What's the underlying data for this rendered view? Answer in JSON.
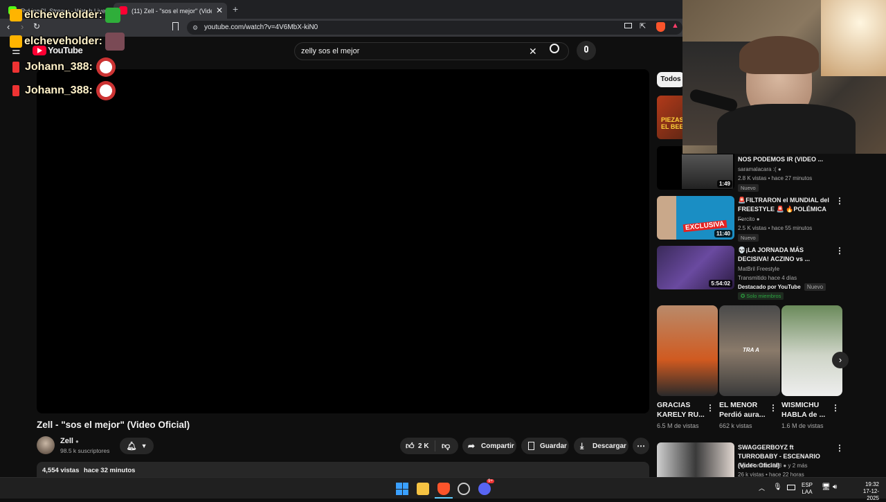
{
  "browser": {
    "tabs": [
      {
        "label": "RykingCL Stream - Watch Live on Kick",
        "active": false
      },
      {
        "label": "(11) Zell - \"sos el mejor\" (Video Oficial)",
        "active": true
      }
    ],
    "url": "youtube.com/watch?v=4V6MbX-kiN0"
  },
  "youtube": {
    "logo": "YouTube",
    "search_value": "zelly sos el mejor",
    "video": {
      "title": "Zell - \"sos el mejor\" (Video Oficial)",
      "channel": "Zell",
      "subscribers": "98.5 k suscriptores",
      "likes": "2 K",
      "share_label": "Compartir",
      "save_label": "Guardar",
      "download_label": "Descargar",
      "views": "4,554 vistas",
      "time": "hace 32 minutos"
    },
    "filter_chip": "Todos",
    "recommendations": [
      {
        "title": "NOS PODEMOS IR (VIDEO ...",
        "channel": "saramalacara :(",
        "meta": "2.8 K vistas • hace 27 minutos",
        "badge": "Nuevo",
        "duration": "1:49"
      },
      {
        "title": "🚨FILTRARON el MUNDIAL del FREESTYLE 🚨 🔥POLÉMICA ...",
        "channel": "Forcito",
        "meta": "2.5 K vistas • hace 55 minutos",
        "badge": "Nuevo",
        "duration": "11:40",
        "thumb_text": "EXCLUSIVA"
      },
      {
        "title": "💀¡LA JORNADA MÁS DECISIVA! ACZINO vs ...",
        "channel": "MatBril Freestyle",
        "meta": "Transmitido hace 4 días",
        "featured": "Destacado por YouTube",
        "badge": "Nuevo",
        "members": "Solo miembros",
        "duration": "5:54:02"
      }
    ],
    "shorts": [
      {
        "title": "GRACIAS KARELY RU...",
        "views": "6.5 M de vistas"
      },
      {
        "title": "EL MENOR Perdió aura...",
        "views": "662 k vistas"
      },
      {
        "title": "WISMICHU HABLA de ...",
        "views": "1.6 M de vistas"
      }
    ],
    "last_rec": {
      "title": "SWAGGERBOYZ ft TURROBABY - ESCENARIO (Video Oficial)",
      "channel": "AgusFortnite2008",
      "channel_extra": "y 2 más",
      "meta": "26 k vistas • hace 22 horas"
    }
  },
  "chat": [
    {
      "user": "elcheveholder:"
    },
    {
      "user": "elcheveholder:"
    },
    {
      "user": "Johann_388:"
    },
    {
      "user": "Johann_388:"
    }
  ],
  "taskbar": {
    "lang_top": "ESP",
    "lang_bottom": "LAA",
    "time": "19:32",
    "date": "17-12-2025",
    "discord_badge": "9+"
  },
  "colors": {
    "accent_red": "#ff0033",
    "bg": "#0f0f0f",
    "chip": "#272727",
    "kick_green": "#53fc18"
  }
}
